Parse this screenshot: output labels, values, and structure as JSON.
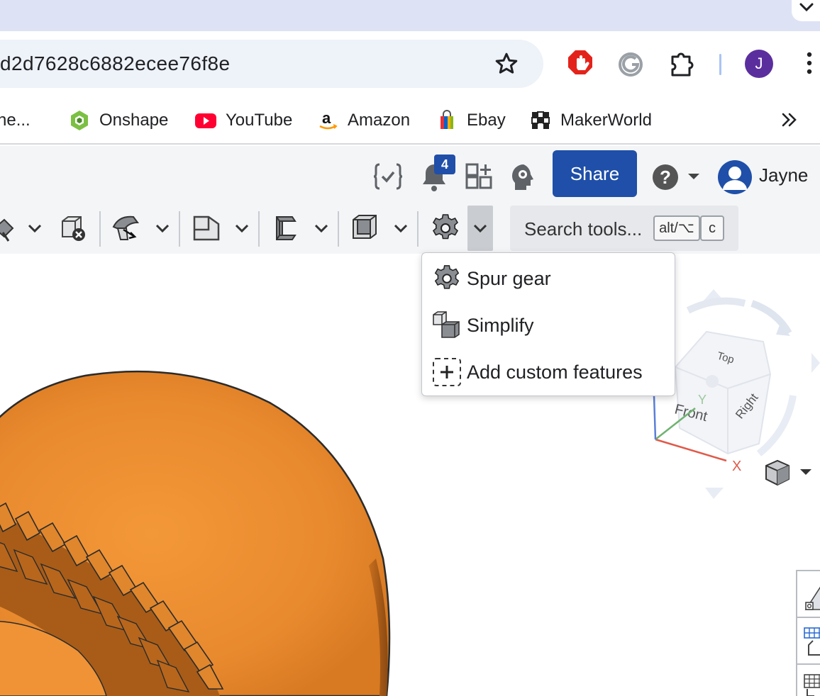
{
  "browser": {
    "url": "d2d7628c6882ecee76f8e",
    "profile_initial": "J",
    "icons": [
      "chevron-down-icon",
      "star-icon",
      "adblock-hand-icon",
      "grammarly-icon",
      "extensions-puzzle-icon",
      "kebab-menu-icon"
    ],
    "bookmarks": [
      {
        "label": "ne...",
        "icon": "none"
      },
      {
        "label": "Onshape",
        "icon": "onshape-logo-icon"
      },
      {
        "label": "YouTube",
        "icon": "youtube-logo-icon"
      },
      {
        "label": "Amazon",
        "icon": "amazon-logo-icon"
      },
      {
        "label": "Ebay",
        "icon": "ebay-bag-icon"
      },
      {
        "label": "MakerWorld",
        "icon": "makerworld-logo-icon"
      }
    ],
    "bookmarks_overflow": "»"
  },
  "onshape": {
    "header": {
      "notification_count": "4",
      "share_label": "Share",
      "user_name": "Jayne",
      "icons": [
        "featurescript-icon",
        "notifications-bell-icon",
        "app-store-icon",
        "learning-center-icon",
        "help-icon",
        "user-avatar-icon"
      ]
    },
    "toolbar": {
      "tools": [
        "sketch-tool-icon",
        "delete-part-icon",
        "sweep-tool-icon",
        "plane-tool-icon",
        "sheet-metal-icon",
        "shell-tool-icon",
        "spur-gear-tool-icon"
      ],
      "search_placeholder": "Search tools...",
      "shortcut_keys": [
        "alt/⌥",
        "c"
      ]
    },
    "gear_menu": {
      "items": [
        {
          "label": "Spur gear",
          "icon": "spur-gear-icon"
        },
        {
          "label": "Simplify",
          "icon": "simplify-icon"
        },
        {
          "label": "Add custom features",
          "icon": "add-custom-features-icon"
        }
      ]
    },
    "viewcube": {
      "faces": [
        "Top",
        "Front",
        "Right"
      ],
      "axes": [
        "X",
        "Y"
      ]
    },
    "colors": {
      "accent": "#1f4fa8",
      "gear_orange": "#e88b30",
      "tabstrip": "#dde3f4"
    }
  }
}
